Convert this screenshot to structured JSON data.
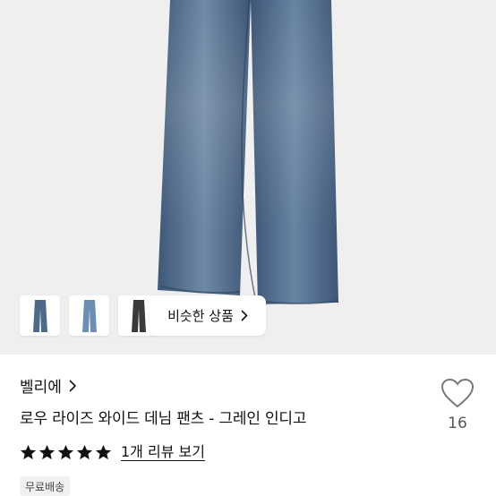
{
  "similar": {
    "label": "비슷한 상품",
    "chevron_icon": "chevron-right-icon"
  },
  "thumbnails": [
    {
      "name": "thumb-indigo-jeans",
      "color": "#4d6a88"
    },
    {
      "name": "thumb-light-blue-jeans",
      "color": "#6d8eb3"
    },
    {
      "name": "thumb-black-jeans",
      "color": "#3a3a3a"
    }
  ],
  "product": {
    "brand": "벨리에",
    "title": "로우 라이즈 와이드 데님 팬츠 - 그레인 인디고",
    "likes": "16",
    "rating": 5,
    "review_link": "1개 리뷰 보기",
    "shipping_badge": "무료배송"
  },
  "colors": {
    "denim": "#4a6585",
    "hero_bg": "#efefef",
    "star": "#111111"
  }
}
